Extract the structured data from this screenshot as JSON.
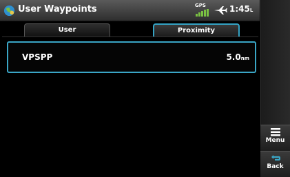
{
  "header": {
    "title": "User Waypoints",
    "gps_label": "GPS",
    "time": "1:45",
    "time_suffix": "L"
  },
  "tabs": [
    {
      "label": "User",
      "active": false
    },
    {
      "label": "Proximity",
      "active": true
    }
  ],
  "waypoints": [
    {
      "name": "VPSPP",
      "distance": "5.0",
      "unit": "nm"
    }
  ],
  "side_buttons": {
    "menu_label": "Menu",
    "back_label": "Back"
  },
  "colors": {
    "accent": "#3aa6c6",
    "background": "#000000"
  }
}
